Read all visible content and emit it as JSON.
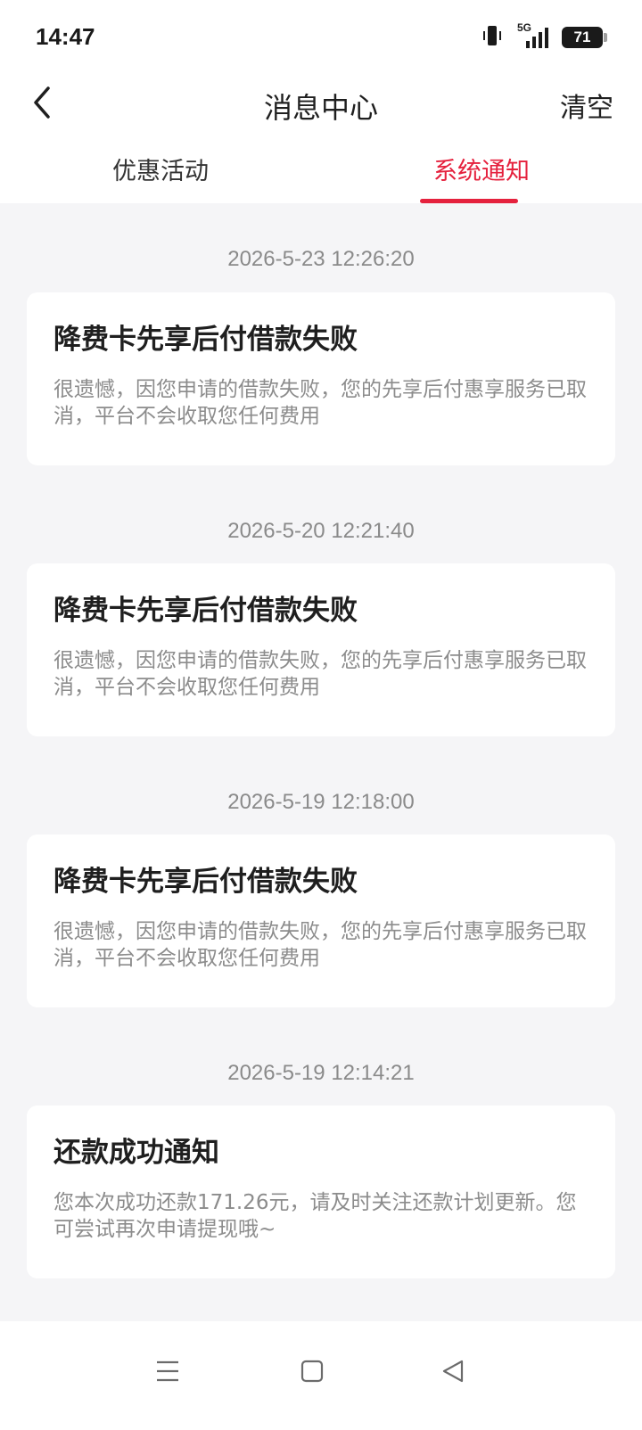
{
  "status_bar": {
    "time": "14:47",
    "network": "5G",
    "battery": "71",
    "icons": [
      "vibrate-icon",
      "signal-5g-icon",
      "battery-icon"
    ]
  },
  "nav": {
    "back_icon": "chevron-left-icon",
    "title": "消息中心",
    "clear_label": "清空"
  },
  "tabs": [
    {
      "label": "优惠活动",
      "active": false
    },
    {
      "label": "系统通知",
      "active": true
    }
  ],
  "messages": [
    {
      "time": "2026-5-23 12:26:20",
      "title": "降费卡先享后付借款失败",
      "body": "很遗憾，因您申请的借款失败，您的先享后付惠享服务已取消，平台不会收取您任何费用"
    },
    {
      "time": "2026-5-20 12:21:40",
      "title": "降费卡先享后付借款失败",
      "body": "很遗憾，因您申请的借款失败，您的先享后付惠享服务已取消，平台不会收取您任何费用"
    },
    {
      "time": "2026-5-19 12:18:00",
      "title": "降费卡先享后付借款失败",
      "body": "很遗憾，因您申请的借款失败，您的先享后付惠享服务已取消，平台不会收取您任何费用"
    },
    {
      "time": "2026-5-19 12:14:21",
      "title": "还款成功通知",
      "body": "您本次成功还款171.26元，请及时关注还款计划更新。您可尝试再次申请提现哦~"
    }
  ],
  "system_nav": {
    "icons": [
      "menu-icon",
      "home-square-icon",
      "back-triangle-icon"
    ]
  },
  "colors": {
    "accent": "#e5213d",
    "background": "#f5f5f7",
    "card": "#ffffff",
    "muted_text": "#8c8c8c"
  }
}
